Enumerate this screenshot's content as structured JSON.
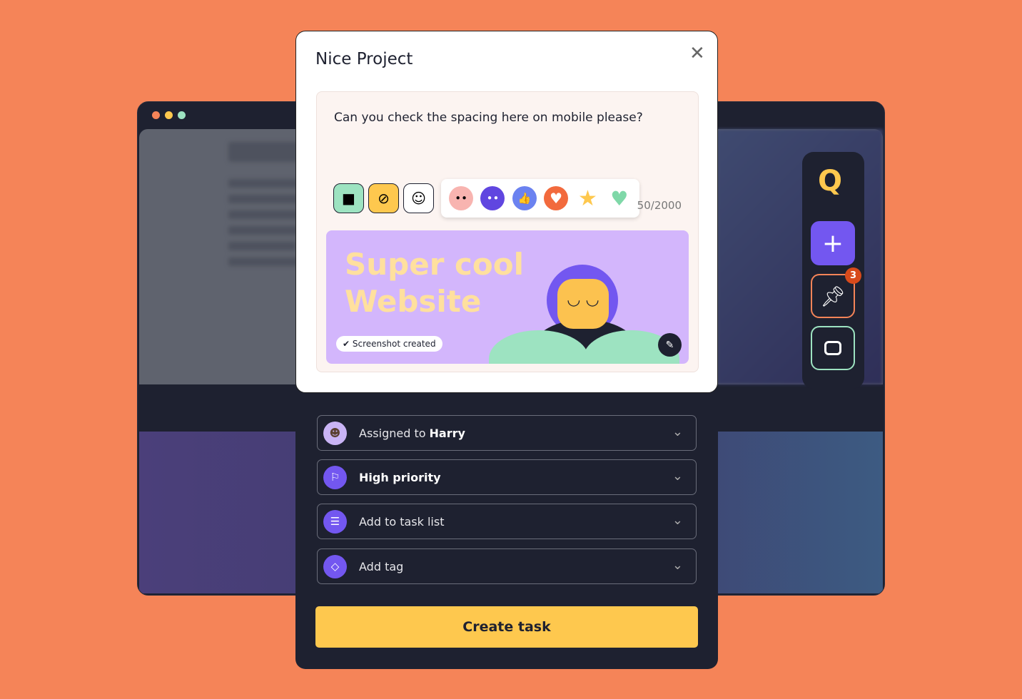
{
  "background_window": {
    "dot_colors": [
      "#f58458",
      "#fec84e",
      "#9de3c1"
    ]
  },
  "modal": {
    "title": "Nice Project",
    "close_icon": "close-icon",
    "comment": "Can you check the spacing here on mobile please?",
    "tools": [
      {
        "icon": "video-icon",
        "color": "#9de3c1"
      },
      {
        "icon": "paperclip-icon",
        "color": "#fec84e"
      },
      {
        "icon": "smiley-icon",
        "color": "#ffffff"
      }
    ],
    "reactions": [
      "pink-blob-emoji",
      "purple-flower-emoji",
      "thumbs-up-emoji",
      "heart-emoji",
      "star-emoji",
      "green-heart-emoji"
    ],
    "char_count": "50/2000",
    "screenshot": {
      "title_line1": "Super cool",
      "title_line2": "Website",
      "badge": "Screenshot created"
    }
  },
  "fields": [
    {
      "prefix": "Assigned to",
      "value": "Harry",
      "icon": "avatar"
    },
    {
      "prefix": "",
      "value": "High priority",
      "icon": "flag-icon"
    },
    {
      "prefix": "Add to task list",
      "value": "",
      "icon": "list-icon"
    },
    {
      "prefix": "Add tag",
      "value": "",
      "icon": "tag-icon"
    }
  ],
  "create_button": "Create task",
  "sidebar": {
    "logo": "Q",
    "notification_count": "3",
    "accent": "#7357f0"
  }
}
